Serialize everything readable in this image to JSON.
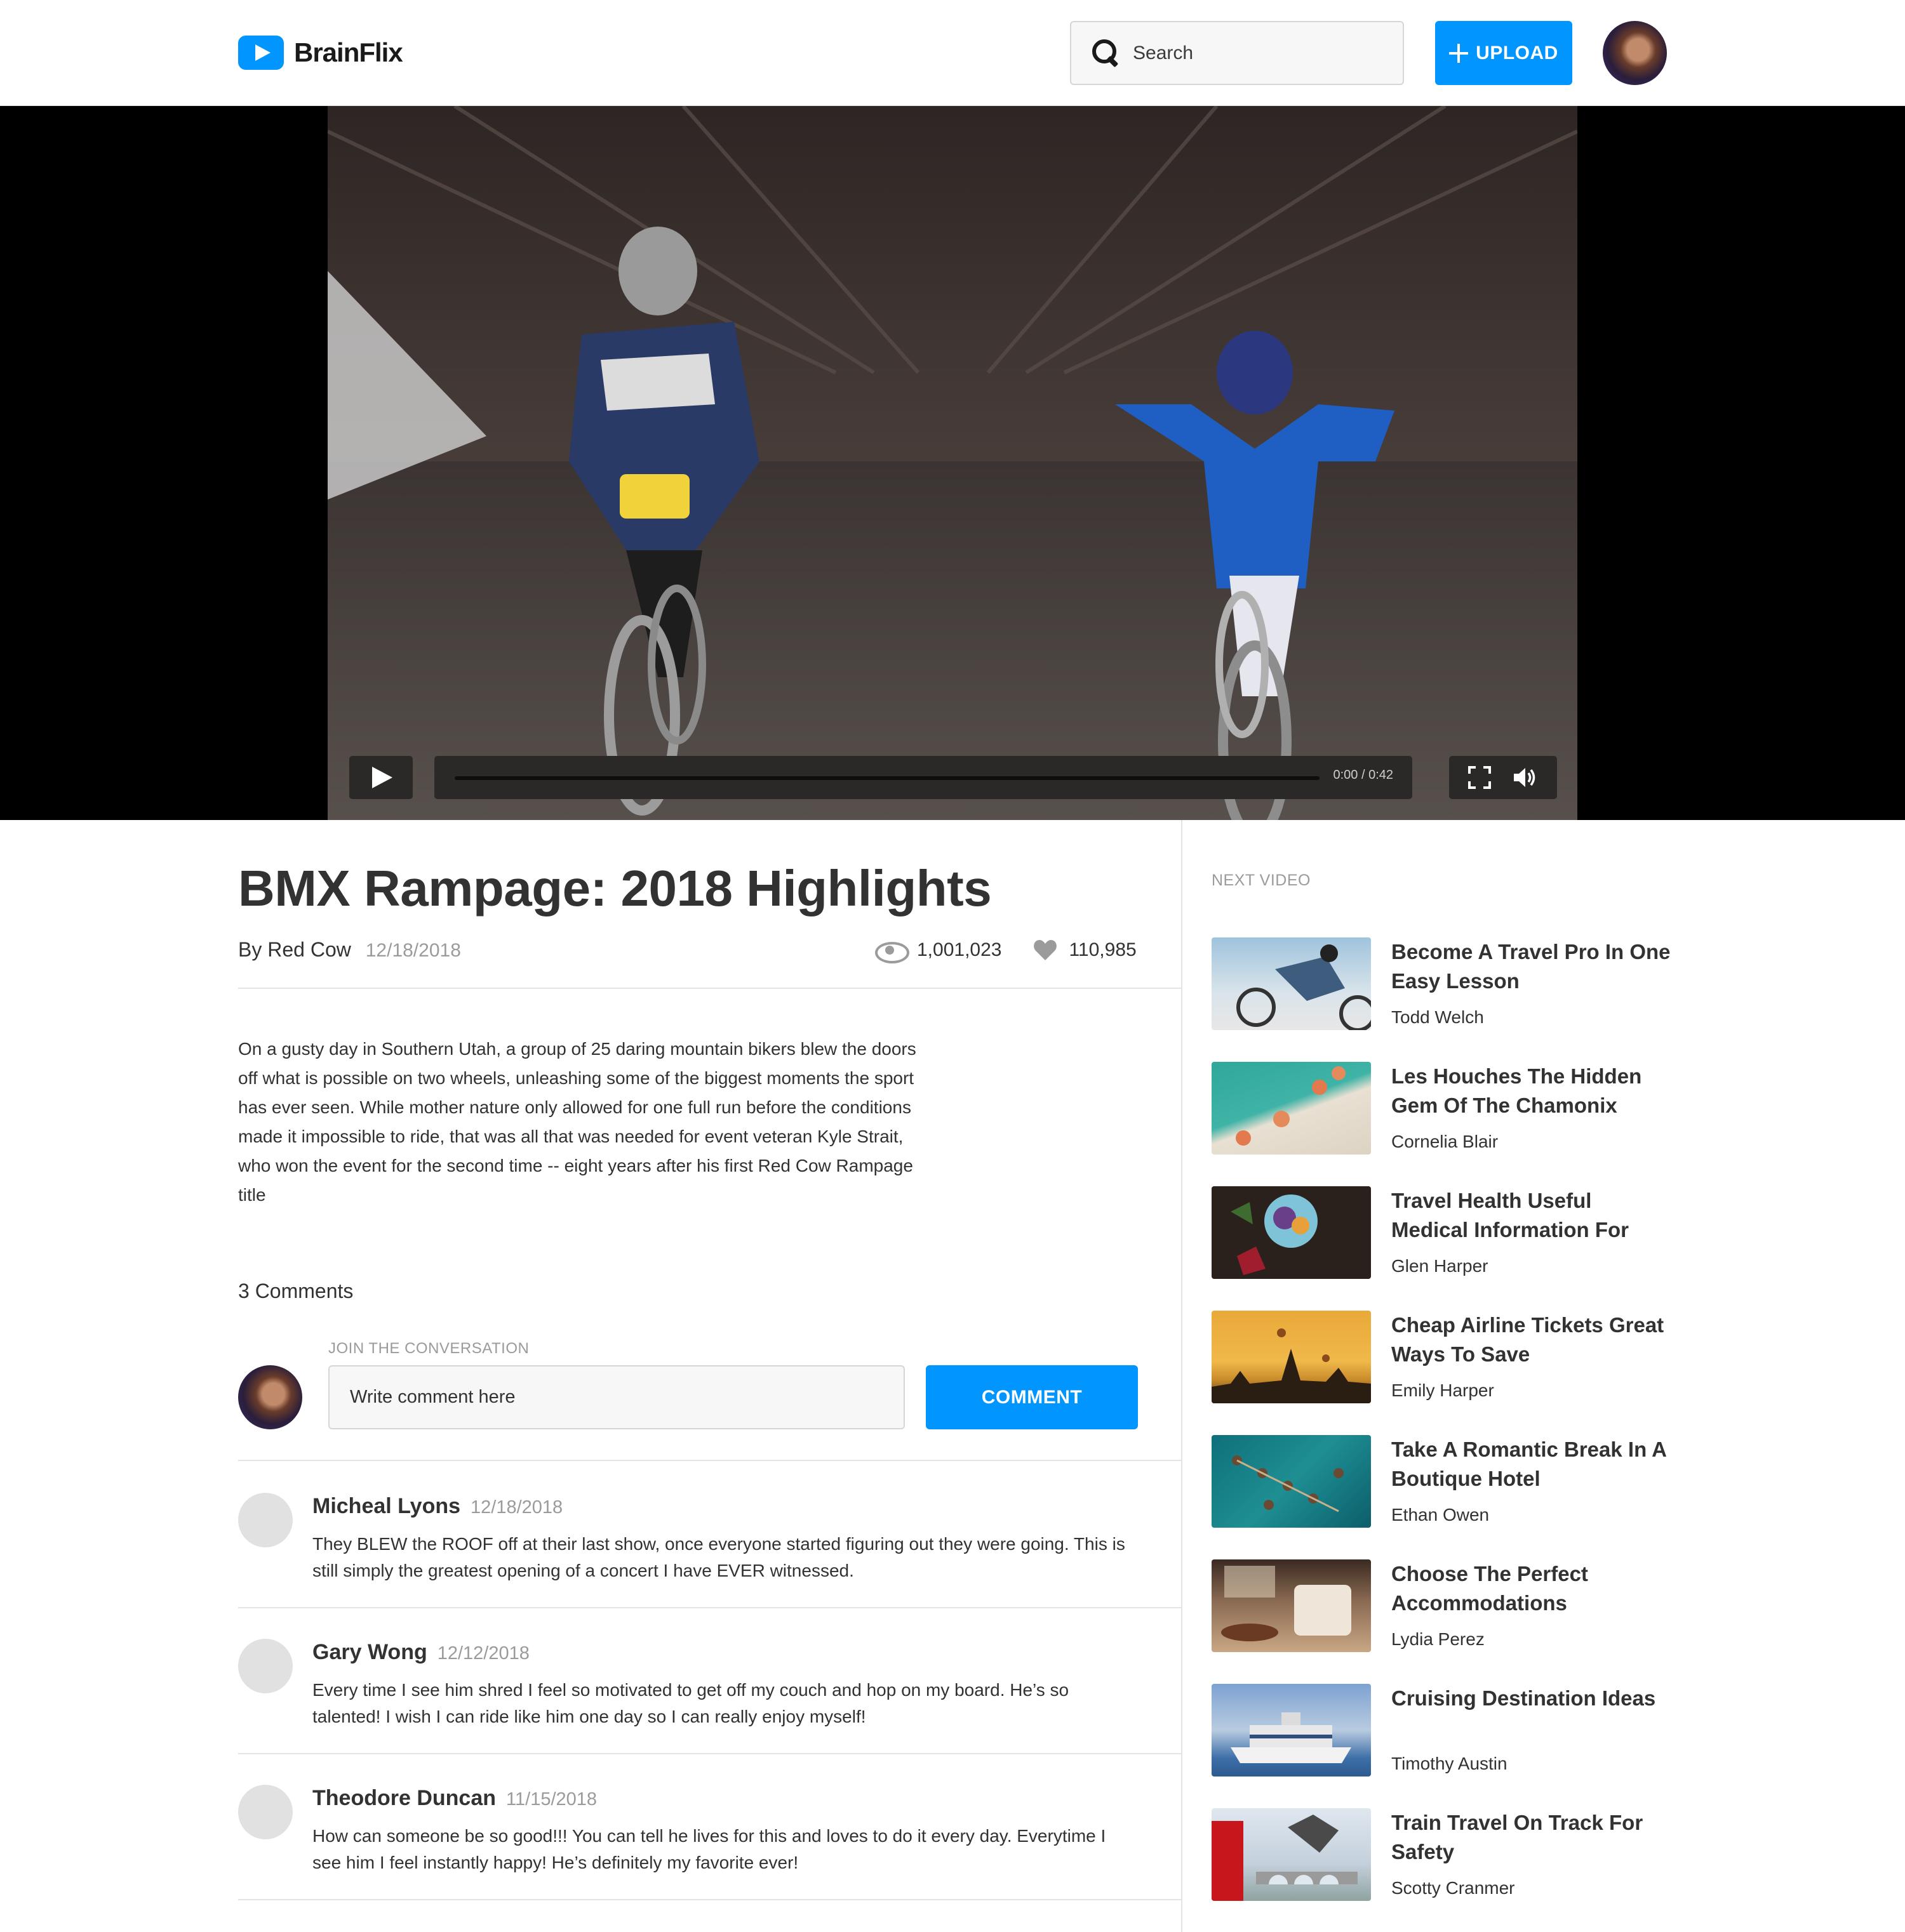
{
  "app": {
    "name": "BrainFlix"
  },
  "header": {
    "search_placeholder": "Search",
    "upload_label": "UPLOAD"
  },
  "player": {
    "time": "0:00 / 0:42",
    "progress": 0
  },
  "video": {
    "title": "BMX Rampage: 2018 Highlights",
    "author": "By Red Cow",
    "date": "12/18/2018",
    "views": "1,001,023",
    "likes": "110,985",
    "description": "On a gusty day in Southern Utah, a group of 25 daring mountain bikers blew the doors off what is possible on two wheels, unleashing some of the biggest moments the sport has ever seen. While mother nature only allowed for one full run before the conditions made it impossible to ride, that was all that was needed for event veteran Kyle Strait, who won the event for the second time -- eight years after his first Red Cow Rampage title"
  },
  "comments": {
    "count_label": "3 Comments",
    "join_label": "JOIN THE CONVERSATION",
    "input_placeholder": "Write comment here",
    "button_label": "COMMENT",
    "items": [
      {
        "name": "Micheal Lyons",
        "date": "12/18/2018",
        "text": "They BLEW the ROOF off at their last show, once everyone started figuring out they were going. This is still simply the greatest opening of a concert I have EVER witnessed."
      },
      {
        "name": "Gary Wong",
        "date": "12/12/2018",
        "text": "Every time I see him shred I feel so motivated to get off my couch and hop on my board. He’s so talented! I wish I can ride like him one day so I can really enjoy myself!"
      },
      {
        "name": "Theodore Duncan",
        "date": "11/15/2018",
        "text": "How can someone be so good!!! You can tell he lives for this and loves to do it every day. Everytime I see him I feel instantly happy! He’s definitely my favorite ever!"
      }
    ]
  },
  "sidebar": {
    "label": "NEXT VIDEO",
    "items": [
      {
        "title": "Become A Travel Pro In One Easy Lesson",
        "author": "Todd Welch"
      },
      {
        "title": "Les Houches The Hidden Gem Of The Chamonix",
        "author": "Cornelia Blair"
      },
      {
        "title": "Travel Health Useful Medical Information For",
        "author": "Glen Harper"
      },
      {
        "title": "Cheap Airline Tickets Great Ways To Save",
        "author": "Emily Harper"
      },
      {
        "title": "Take A Romantic Break In A Boutique Hotel",
        "author": "Ethan Owen"
      },
      {
        "title": "Choose The Perfect Accommodations",
        "author": "Lydia Perez"
      },
      {
        "title": "Cruising Destination Ideas",
        "author": "Timothy Austin"
      },
      {
        "title": "Train Travel On Track For Safety",
        "author": "Scotty Cranmer"
      }
    ]
  }
}
